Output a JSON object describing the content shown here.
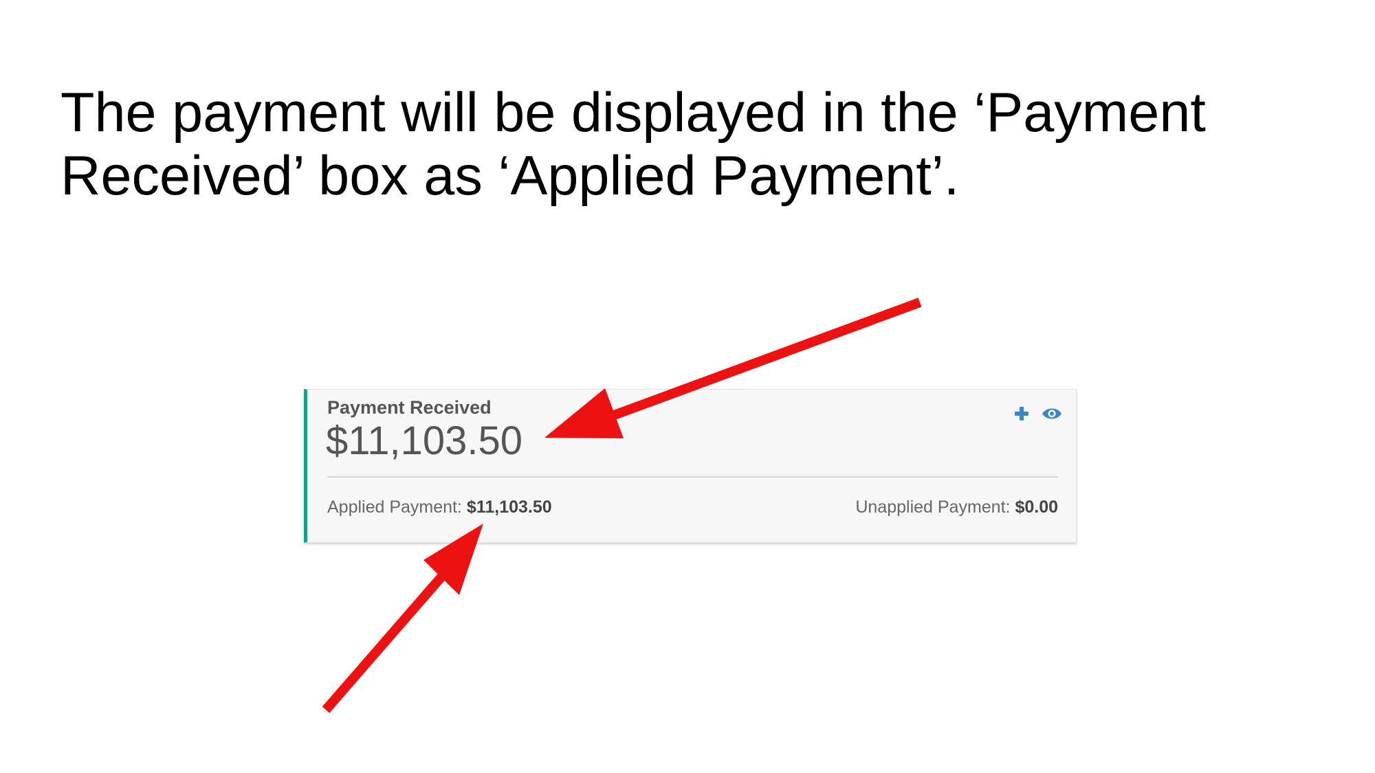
{
  "slide": {
    "title": "The payment will be displayed in the ‘Payment Received’ box as ‘Applied Payment’."
  },
  "card": {
    "title": "Payment Received",
    "amount": "$11,103.50",
    "applied_label": "Applied Payment:",
    "applied_value": "$11,103.50",
    "unapplied_label": "Unapplied Payment:",
    "unapplied_value": "$0.00",
    "icons": [
      "plus-icon",
      "eye-icon"
    ]
  },
  "colors": {
    "accent": "#17a08a",
    "icon": "#3a86c8",
    "arrow": "#ee1111"
  }
}
